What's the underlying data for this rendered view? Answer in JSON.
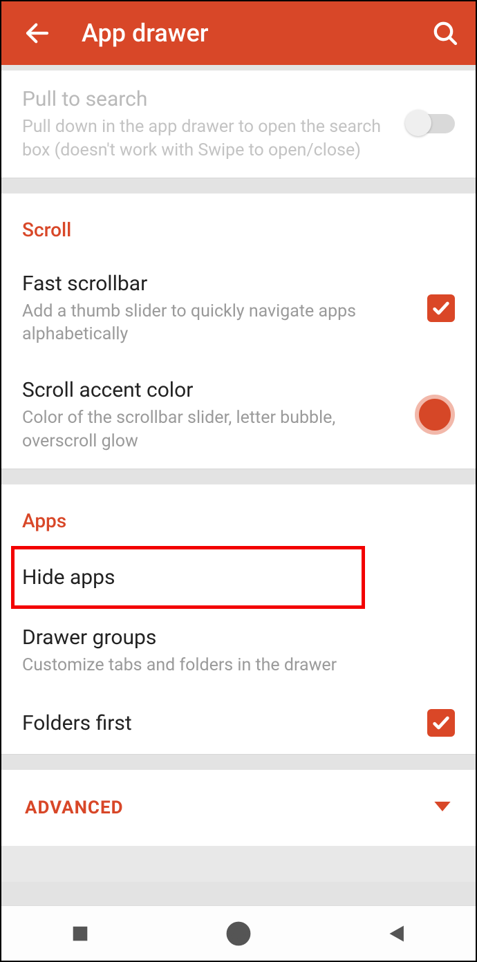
{
  "colors": {
    "accent": "#d84728"
  },
  "appbar": {
    "title": "App drawer",
    "back_icon": "arrow-back",
    "search_icon": "search"
  },
  "sections": {
    "pull": {
      "title": "Pull to search",
      "subtitle": "Pull down in the app drawer to open the search box (doesn't work with Swipe to open/close)",
      "enabled": false,
      "switch_on": false
    },
    "scroll": {
      "header": "Scroll",
      "fast_scrollbar": {
        "title": "Fast scrollbar",
        "subtitle": "Add a thumb slider to quickly navigate apps alphabetically",
        "checked": true
      },
      "accent_color": {
        "title": "Scroll accent color",
        "subtitle": "Color of the scrollbar slider, letter bubble, overscroll glow",
        "color": "#d64727"
      }
    },
    "apps": {
      "header": "Apps",
      "hide_apps": {
        "title": "Hide apps",
        "highlighted": true
      },
      "drawer_groups": {
        "title": "Drawer groups",
        "subtitle": "Customize tabs and folders in the drawer"
      },
      "folders_first": {
        "title": "Folders first",
        "checked": true
      }
    },
    "advanced": {
      "label": "ADVANCED",
      "expanded": false
    }
  },
  "navbar": {
    "recent": "recent-apps",
    "home": "home",
    "back": "back"
  }
}
